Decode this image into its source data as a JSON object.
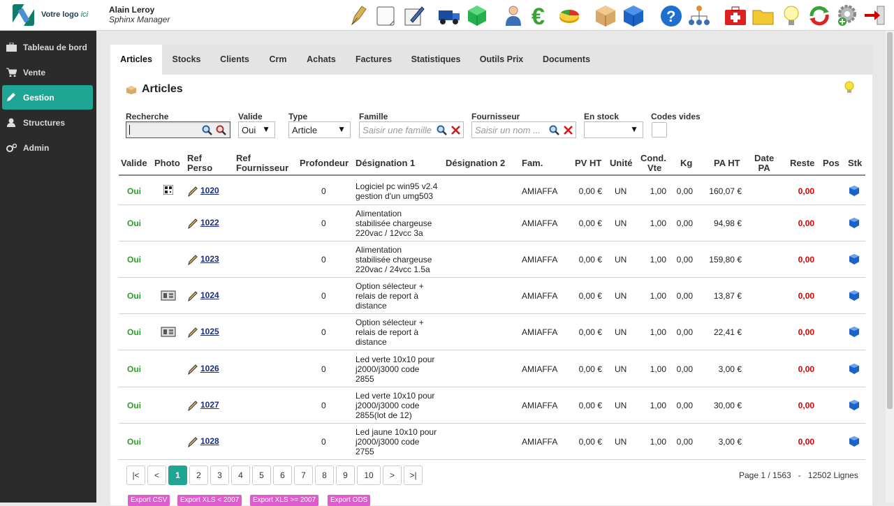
{
  "logo": {
    "text": "Votre logo",
    "text_em": "ici"
  },
  "user": {
    "name": "Alain Leroy",
    "role": "Sphinx Manager"
  },
  "toolbar_icons": [
    "pen-nib-icon",
    "note-icon",
    "edit-pen-icon",
    "truck-icon",
    "green-cube-icon",
    "person-icon",
    "euro-icon",
    "pie-chart-icon",
    "box-icon",
    "blue-cube-icon",
    "help-icon",
    "network-icon",
    "first-aid-icon",
    "folder-icon",
    "lightbulb-icon",
    "refresh-icon",
    "settings-add-icon",
    "logout-icon"
  ],
  "sidebar": {
    "items": [
      {
        "label": "Tableau de bord",
        "icon": "briefcase-icon"
      },
      {
        "label": "Vente",
        "icon": "cart-icon"
      },
      {
        "label": "Gestion",
        "icon": "pencil-icon",
        "active": true
      },
      {
        "label": "Structures",
        "icon": "user-icon"
      },
      {
        "label": "Admin",
        "icon": "gears-icon"
      }
    ]
  },
  "tabs": [
    "Articles",
    "Stocks",
    "Clients",
    "Crm",
    "Achats",
    "Factures",
    "Statistiques",
    "Outils Prix",
    "Documents"
  ],
  "page": {
    "title": "Articles"
  },
  "filters": {
    "recherche": {
      "label": "Recherche",
      "value": ""
    },
    "valide": {
      "label": "Valide",
      "value": "Oui"
    },
    "type": {
      "label": "Type",
      "value": "Article"
    },
    "famille": {
      "label": "Famille",
      "placeholder": "Saisir une famille"
    },
    "fournisseur": {
      "label": "Fournisseur",
      "placeholder": "Saisir un nom ..."
    },
    "en_stock": {
      "label": "En stock",
      "value": ""
    },
    "codes_vides": {
      "label": "Codes vides"
    }
  },
  "table": {
    "headers": {
      "valide": "Valide",
      "photo": "Photo",
      "ref_perso_1": "Ref",
      "ref_perso_2": "Perso",
      "ref_fourn_1": "Ref",
      "ref_fourn_2": "Fournisseur",
      "profondeur": "Profondeur",
      "des1": "Désignation 1",
      "des2": "Désignation 2",
      "fam": "Fam.",
      "pvht": "PV HT",
      "unite": "Unité",
      "cond_1": "Cond.",
      "cond_2": "Vte",
      "kg": "Kg",
      "paht": "PA HT",
      "datepa_1": "Date",
      "datepa_2": "PA",
      "reste": "Reste",
      "pos": "Pos",
      "stk": "Stk"
    },
    "rows": [
      {
        "valide": "Oui",
        "photo": "qr",
        "ref": "1020",
        "profondeur": "0",
        "des1": [
          "Logiciel pc win95 v2.4",
          "gestion d'un umg503"
        ],
        "fam": "AMIAFFA",
        "pvht": "0,00 €",
        "unite": "UN",
        "cond": "1,00",
        "kg": "0,00",
        "paht": "160,07 €",
        "reste": "0,00"
      },
      {
        "valide": "Oui",
        "photo": "",
        "ref": "1022",
        "profondeur": "0",
        "des1": [
          "Alimentation",
          "stabilisée chargeuse",
          "220vac / 12vcc 3a"
        ],
        "fam": "AMIAFFA",
        "pvht": "0,00 €",
        "unite": "UN",
        "cond": "1,00",
        "kg": "0,00",
        "paht": "94,98 €",
        "reste": "0,00"
      },
      {
        "valide": "Oui",
        "photo": "",
        "ref": "1023",
        "profondeur": "0",
        "des1": [
          "Alimentation",
          "stabilisée chargeuse",
          "220vac / 24vcc 1.5a"
        ],
        "fam": "AMIAFFA",
        "pvht": "0,00 €",
        "unite": "UN",
        "cond": "1,00",
        "kg": "0,00",
        "paht": "159,80 €",
        "reste": "0,00"
      },
      {
        "valide": "Oui",
        "photo": "device",
        "ref": "1024",
        "profondeur": "0",
        "des1": [
          "Option sélecteur +",
          "relais de report à",
          "distance"
        ],
        "fam": "AMIAFFA",
        "pvht": "0,00 €",
        "unite": "UN",
        "cond": "1,00",
        "kg": "0,00",
        "paht": "13,87 €",
        "reste": "0,00"
      },
      {
        "valide": "Oui",
        "photo": "device",
        "ref": "1025",
        "profondeur": "0",
        "des1": [
          "Option sélecteur +",
          "relais de report à",
          "distance"
        ],
        "fam": "AMIAFFA",
        "pvht": "0,00 €",
        "unite": "UN",
        "cond": "1,00",
        "kg": "0,00",
        "paht": "22,41 €",
        "reste": "0,00"
      },
      {
        "valide": "Oui",
        "photo": "",
        "ref": "1026",
        "profondeur": "0",
        "des1": [
          "Led verte 10x10 pour",
          "j2000/j3000 code",
          "2855"
        ],
        "fam": "AMIAFFA",
        "pvht": "0,00 €",
        "unite": "UN",
        "cond": "1,00",
        "kg": "0,00",
        "paht": "3,00 €",
        "reste": "0,00"
      },
      {
        "valide": "Oui",
        "photo": "",
        "ref": "1027",
        "profondeur": "0",
        "des1": [
          "Led verte 10x10 pour",
          "j2000/j3000 code",
          "2855(lot de 12)"
        ],
        "fam": "AMIAFFA",
        "pvht": "0,00 €",
        "unite": "UN",
        "cond": "1,00",
        "kg": "0,00",
        "paht": "30,00 €",
        "reste": "0,00"
      },
      {
        "valide": "Oui",
        "photo": "",
        "ref": "1028",
        "profondeur": "0",
        "des1": [
          "Led jaune 10x10 pour",
          "j2000/j3000 code",
          "2755"
        ],
        "fam": "AMIAFFA",
        "pvht": "0,00 €",
        "unite": "UN",
        "cond": "1,00",
        "kg": "0,00",
        "paht": "3,00 €",
        "reste": "0,00"
      }
    ]
  },
  "pagination": {
    "buttons": [
      "|<",
      "<",
      "1",
      "2",
      "3",
      "4",
      "5",
      "6",
      "7",
      "8",
      "9",
      "10",
      ">",
      ">|"
    ],
    "current": "1",
    "page_label": "Page 1 / 1563",
    "separator": "-",
    "lines_label": "12502 Lignes"
  },
  "exports": [
    "Export CSV",
    "Export XLS < 2007",
    "Export XLS >= 2007",
    "Export ODS"
  ]
}
